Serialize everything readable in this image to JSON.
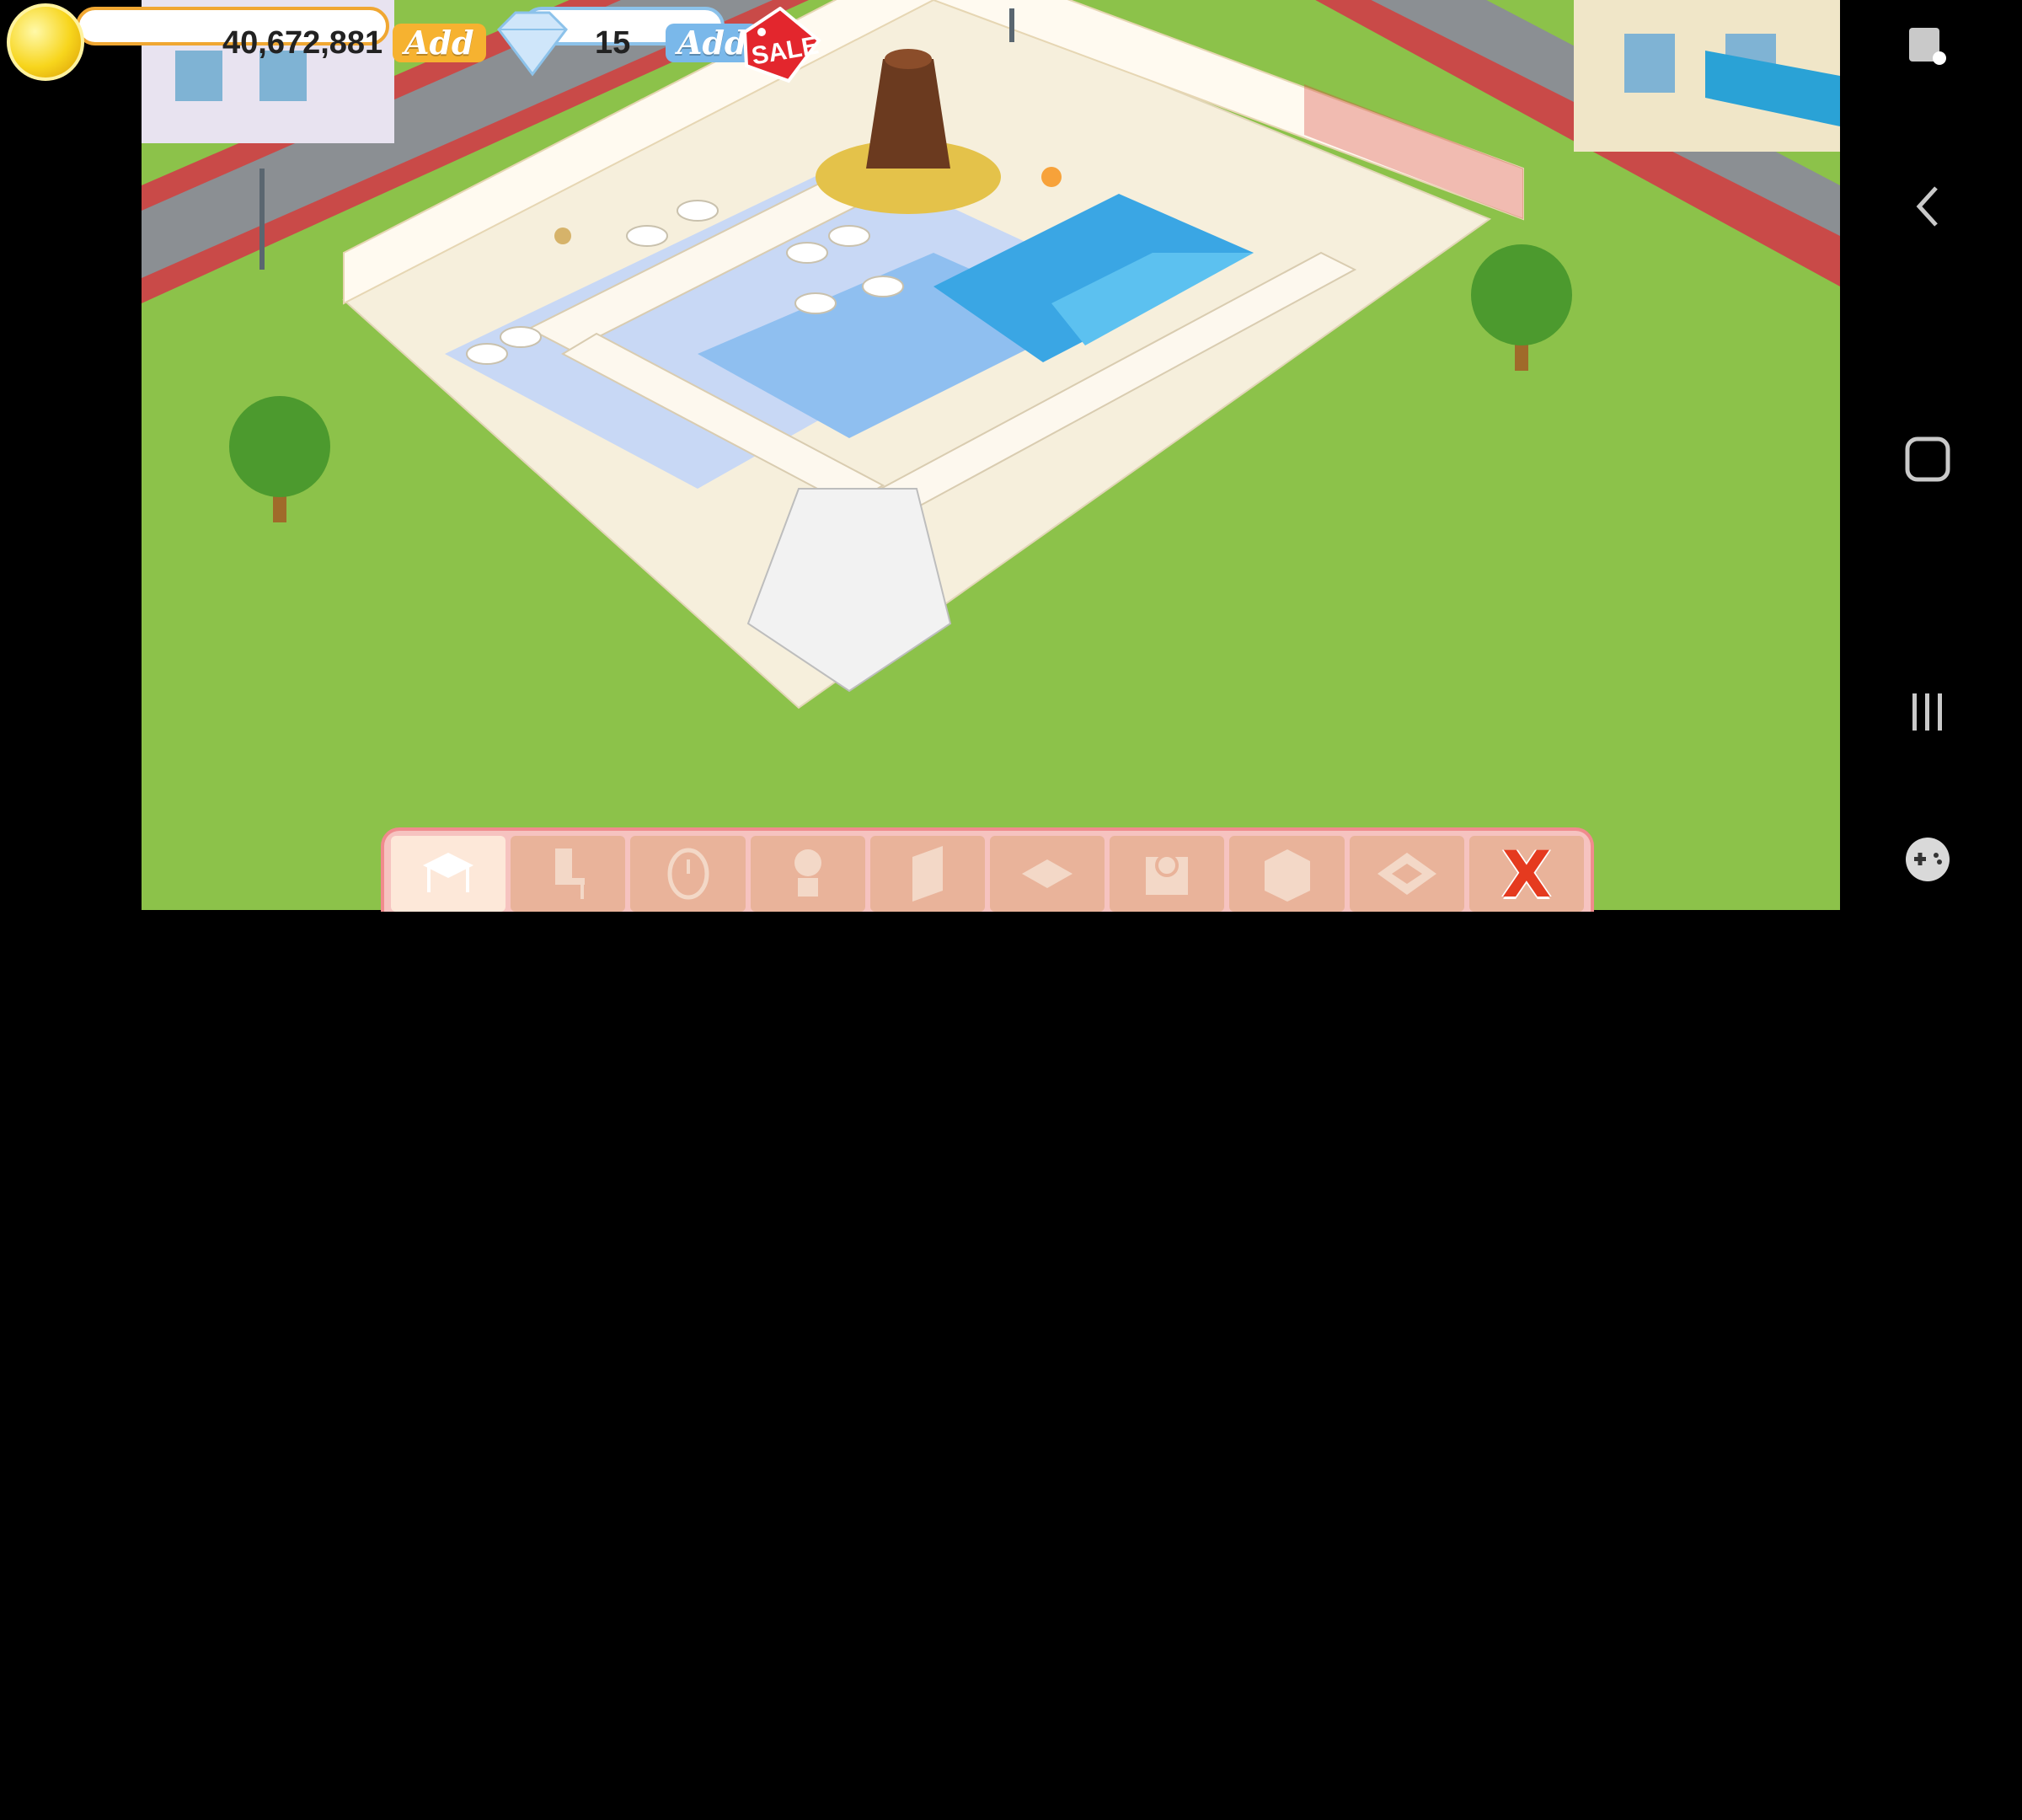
{
  "hud": {
    "coins": "40,672,881",
    "coin_add_label": "Add",
    "gems": "15",
    "gem_add_label": "Add",
    "sale_label": "SALE",
    "coin_icon": "gold-coin-icon",
    "gem_icon": "diamond-icon"
  },
  "toolbar": {
    "tools": [
      {
        "name": "table-tool",
        "icon": "table-icon",
        "active": true
      },
      {
        "name": "chair-tool",
        "icon": "chair-icon"
      },
      {
        "name": "clock-tool",
        "icon": "clock-icon"
      },
      {
        "name": "plant-tool",
        "icon": "plant-icon"
      },
      {
        "name": "wall-tool",
        "icon": "wall-icon"
      },
      {
        "name": "floor-tool",
        "icon": "floor-icon"
      },
      {
        "name": "stove-tool",
        "icon": "stove-icon"
      },
      {
        "name": "counter-tool",
        "icon": "counter-icon"
      },
      {
        "name": "expand-tool",
        "icon": "expand-icon"
      }
    ],
    "close_label": "X"
  },
  "system_nav": [
    "screenshot-icon",
    "back-icon",
    "home-icon",
    "recents-icon",
    "game-tools-icon"
  ],
  "colors": {
    "grass": "#8cc24a",
    "floor": "#f6efdc",
    "pool": "#3aa6e4",
    "wall_trim": "#d6463c",
    "accent_coin": "#f6b230",
    "accent_gem": "#7ab8ea"
  }
}
